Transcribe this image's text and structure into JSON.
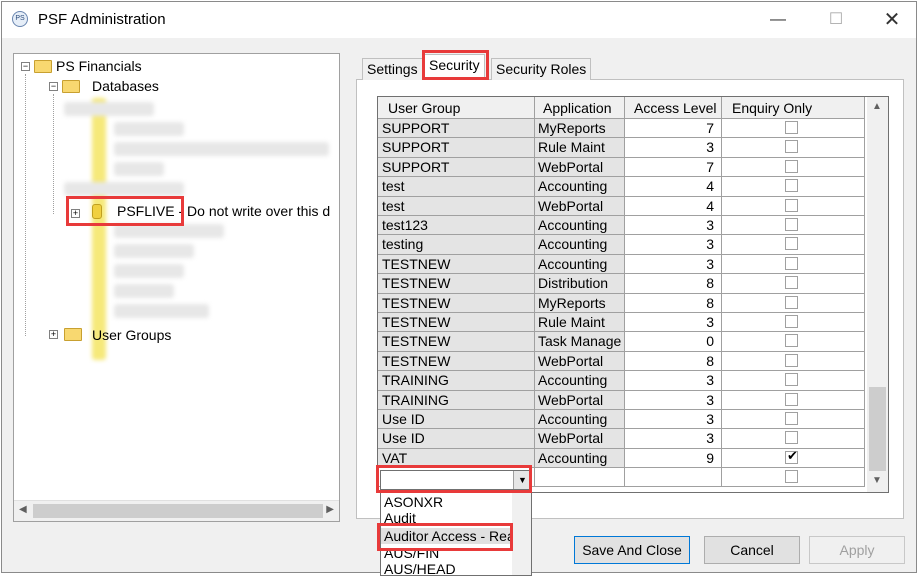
{
  "window": {
    "title": "PSF Administration",
    "icon": "PS",
    "minimize_glyph": "—",
    "maximize_glyph": "☐",
    "close_glyph": "✕"
  },
  "tree": {
    "root": "PS Financials",
    "databases": "Databases",
    "psflive": "PSFLIVE",
    "psflive_note": " - Do not write over this d",
    "user_groups": "User Groups",
    "scroll_left": "◀",
    "scroll_right": "▶"
  },
  "tabs": [
    {
      "label": "Settings"
    },
    {
      "label": "Security"
    },
    {
      "label": "Security Roles"
    }
  ],
  "grid": {
    "headers": [
      "User Group",
      "Application",
      "Access Level",
      "Enquiry Only"
    ],
    "rows": [
      {
        "group": "SUPPORT",
        "app": "MyReports",
        "level": "7",
        "enquiry": false
      },
      {
        "group": "SUPPORT",
        "app": "Rule Maint",
        "level": "3",
        "enquiry": false
      },
      {
        "group": "SUPPORT",
        "app": "WebPortal",
        "level": "7",
        "enquiry": false
      },
      {
        "group": "test",
        "app": "Accounting",
        "level": "4",
        "enquiry": false
      },
      {
        "group": "test",
        "app": "WebPortal",
        "level": "4",
        "enquiry": false
      },
      {
        "group": "test123",
        "app": "Accounting",
        "level": "3",
        "enquiry": false
      },
      {
        "group": "testing",
        "app": "Accounting",
        "level": "3",
        "enquiry": false
      },
      {
        "group": "TESTNEW",
        "app": "Accounting",
        "level": "3",
        "enquiry": false
      },
      {
        "group": "TESTNEW",
        "app": "Distribution",
        "level": "8",
        "enquiry": false
      },
      {
        "group": "TESTNEW",
        "app": "MyReports",
        "level": "8",
        "enquiry": false
      },
      {
        "group": "TESTNEW",
        "app": "Rule Maint",
        "level": "3",
        "enquiry": false
      },
      {
        "group": "TESTNEW",
        "app": "Task Manage",
        "level": "0",
        "enquiry": false
      },
      {
        "group": "TESTNEW",
        "app": "WebPortal",
        "level": "8",
        "enquiry": false
      },
      {
        "group": "TRAINING",
        "app": "Accounting",
        "level": "3",
        "enquiry": false
      },
      {
        "group": "TRAINING",
        "app": "WebPortal",
        "level": "3",
        "enquiry": false
      },
      {
        "group": "Use ID",
        "app": "Accounting",
        "level": "3",
        "enquiry": false
      },
      {
        "group": "Use ID",
        "app": "WebPortal",
        "level": "3",
        "enquiry": false
      },
      {
        "group": "VAT",
        "app": "Accounting",
        "level": "9",
        "enquiry": true
      }
    ],
    "scroll_up": "▲",
    "scroll_down": "▼",
    "tick": "✔"
  },
  "combo": {
    "value": "",
    "arrow": "▼"
  },
  "dropdown_options": [
    "ASONXR",
    "Audit",
    "Auditor Access - Rea",
    "AUS/FIN",
    "AUS/HEAD"
  ],
  "buttons": {
    "save_close": "Save And Close",
    "cancel": "Cancel",
    "apply": "Apply"
  },
  "highlight_color": "#e83a3a"
}
